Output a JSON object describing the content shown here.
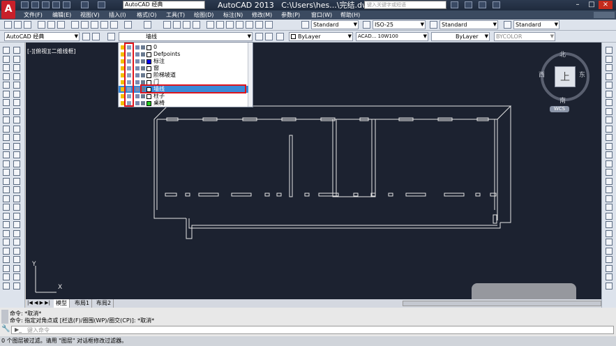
{
  "title_bar": {
    "workspace": "AutoCAD 经典",
    "app_title": "AutoCAD 2013",
    "file_path": "C:\\Users\\hes...\\完结.dwg",
    "search_placeholder": "键入关键字或短语"
  },
  "menu": [
    "文件(F)",
    "编辑(E)",
    "视图(V)",
    "插入(I)",
    "格式(O)",
    "工具(T)",
    "绘图(D)",
    "标注(N)",
    "修改(M)",
    "参数(P)",
    "窗口(W)",
    "帮助(H)"
  ],
  "styles": {
    "text_style": "Standard",
    "dim_style": "ISO-25",
    "table_style": "Standard",
    "mleader_style": "Standard"
  },
  "workspace_combo": "AutoCAD 经典",
  "layer_combo": "墙线",
  "properties": {
    "color": "ByLayer",
    "linetype": "ACAD... 10W100",
    "lineweight": "ByLayer",
    "plotstyle": "BYCOLOR"
  },
  "layers": [
    {
      "name": "0",
      "color": "#ffffff"
    },
    {
      "name": "Defpoints",
      "color": "#ffffff"
    },
    {
      "name": "标注",
      "color": "#0000ff"
    },
    {
      "name": "窗",
      "color": "#ffffff"
    },
    {
      "name": "阶梯坡道",
      "color": "#ffffff"
    },
    {
      "name": "门",
      "color": "#ffffff"
    },
    {
      "name": "墙线",
      "color": "#ffffff",
      "selected": true
    },
    {
      "name": "柱子",
      "color": "#ffffff"
    },
    {
      "name": "桌椅",
      "color": "#22cc22"
    }
  ],
  "viewport_label": "[-][俯视][二维线框]",
  "viewcube": {
    "face": "上",
    "north": "北",
    "south": "南",
    "east": "东",
    "west": "西",
    "wcs": "WCS"
  },
  "ucs": {
    "x": "X",
    "y": "Y"
  },
  "tabs": [
    "模型",
    "布局1",
    "布局2"
  ],
  "command": {
    "line1": "命令: *取消*",
    "line2": "命令: 指定对角点或 [栏选(F)/圈围(WP)/圈交(CP)]: *取消*",
    "prompt": "键入命令"
  },
  "status": "0 个图层被过滤。请用 \"图层\" 对话框修改过滤器。"
}
